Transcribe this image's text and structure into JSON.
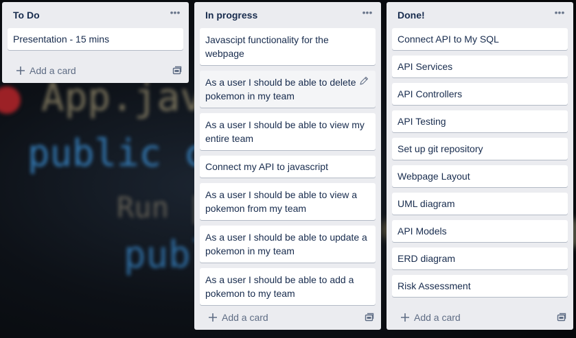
{
  "lists": [
    {
      "title": "To Do",
      "cards": [
        "Presentation - 15 mins"
      ],
      "add_label": "Add a card"
    },
    {
      "title": "In progress",
      "cards": [
        "Javascipt functionality for the webpage",
        "As a user I should be able to delete pokemon in my team",
        "As a user I should be able to view my entire team",
        "Connect my API to javascript",
        "As a user I should be able to view a pokemon from my team",
        "As a user I should be able to update a pokemon in my team",
        "As a user I should be able to add a pokemon to my team"
      ],
      "add_label": "Add a card"
    },
    {
      "title": "Done!",
      "cards": [
        "Connect API to My SQL",
        "API Services",
        "API Controllers",
        "API Testing",
        "Set up git repository",
        "Webpage Layout",
        "UML diagram",
        "API Models",
        "ERD diagram",
        "Risk Assessment"
      ],
      "add_label": "Add a card"
    }
  ],
  "background_code": {
    "line1": "App.java",
    "line2": "public c",
    "line3": "Run |",
    "line4": "publ"
  },
  "menu_glyph": "•••",
  "icons": {
    "list_menu": "ellipsis-icon",
    "add": "plus-icon",
    "template": "card-template-icon",
    "edit": "pencil-icon"
  },
  "colors": {
    "list_bg": "#ebecf0",
    "card_bg": "#ffffff",
    "text": "#172b4d",
    "muted": "#5e6c84"
  }
}
